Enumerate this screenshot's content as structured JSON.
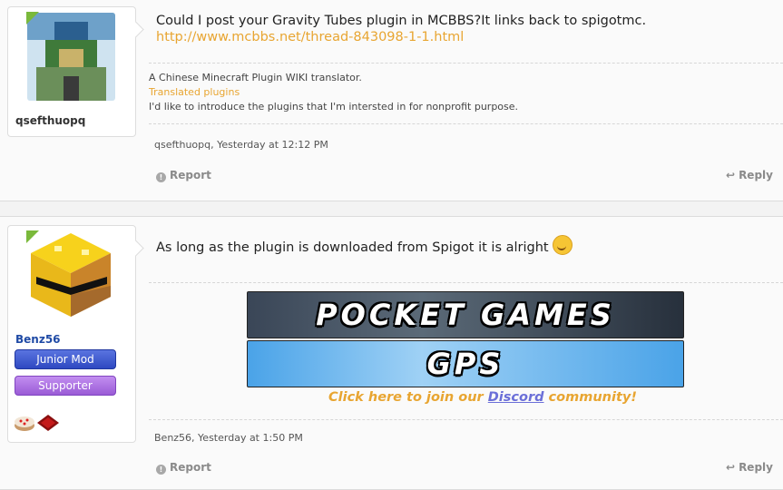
{
  "posts": [
    {
      "username": "qsefthuopq",
      "message": "Could I post your Gravity Tubes plugin in MCBBS?It links back to spigotmc.",
      "link": "http://www.mcbbs.net/thread-843098-1-1.html",
      "signature": {
        "line1": "A Chinese Minecraft Plugin WIKI translator.",
        "link": "Translated plugins",
        "line3": "I'd like to introduce the plugins that I'm intersted in for nonprofit purpose."
      },
      "meta": "qsefthuopq, Yesterday at 12:12 PM",
      "report_label": "Report",
      "reply_label": "Reply"
    },
    {
      "username": "Benz56",
      "badges": [
        "Junior Mod",
        "Supporter"
      ],
      "message": "As long as the plugin is downloaded from Spigot it is alright",
      "banners": [
        "POCKET GAMES",
        "GPS"
      ],
      "cta": {
        "before": "Click here to join our ",
        "link": "Discord",
        "after": " community!"
      },
      "meta": "Benz56, Yesterday at 1:50 PM",
      "report_label": "Report",
      "reply_label": "Reply"
    }
  ],
  "colors": {
    "link": "#e8a531",
    "online": "#7ab93b",
    "junior_mod": "#2e49c1",
    "supporter": "#9a5bd6"
  }
}
